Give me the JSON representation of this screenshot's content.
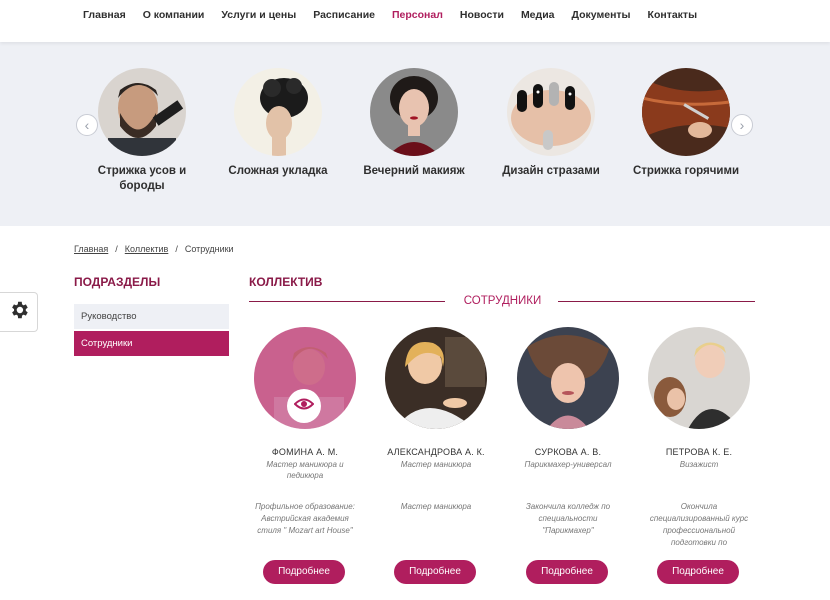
{
  "nav": {
    "items": [
      "Главная",
      "О компании",
      "Услуги и цены",
      "Расписание",
      "Персонал",
      "Новости",
      "Медиа",
      "Документы",
      "Контакты"
    ],
    "active_index": 4
  },
  "services": {
    "prev_icon": "chevron-left-icon",
    "next_icon": "chevron-right-icon",
    "items": [
      {
        "label": "Стрижка усов и бороды"
      },
      {
        "label": "Сложная укладка"
      },
      {
        "label": "Вечерний макияж"
      },
      {
        "label": "Дизайн стразами"
      },
      {
        "label": "Стрижка горячими"
      }
    ]
  },
  "breadcrumb": {
    "items": [
      "Главная",
      "Коллектив",
      "Сотрудники"
    ],
    "separator": "/"
  },
  "sidebar": {
    "title": "ПОДРАЗДЕЛЫ",
    "items": [
      "Руководство",
      "Сотрудники"
    ],
    "active_index": 1
  },
  "main": {
    "title": "КОЛЛЕКТИВ",
    "subtitle": "СОТРУДНИКИ"
  },
  "staff": [
    {
      "name": "ФОМИНА А. М.",
      "role": "Мастер маникюра и педикюра",
      "desc": "Профильное образование: Австрийская академия стиля \" Mozart art House\"",
      "button": "Подробнее"
    },
    {
      "name": "АЛЕКСАНДРОВА А. К.",
      "role": "Мастер маникюра",
      "desc": "Мастер маникюра",
      "button": "Подробнее"
    },
    {
      "name": "СУРКОВА А. В.",
      "role": "Парикмахер-универсал",
      "desc": "Закончила колледж по специальности \"Парикмахер\"",
      "button": "Подробнее"
    },
    {
      "name": "ПЕТРОВА К. Е.",
      "role": "Визажист",
      "desc": "Окончила специализированный курс профессиональной подготовки по",
      "button": "Подробнее"
    }
  ],
  "colors": {
    "accent": "#b01e5e",
    "heading": "#8a1a48",
    "band_bg": "#eef0f5"
  }
}
